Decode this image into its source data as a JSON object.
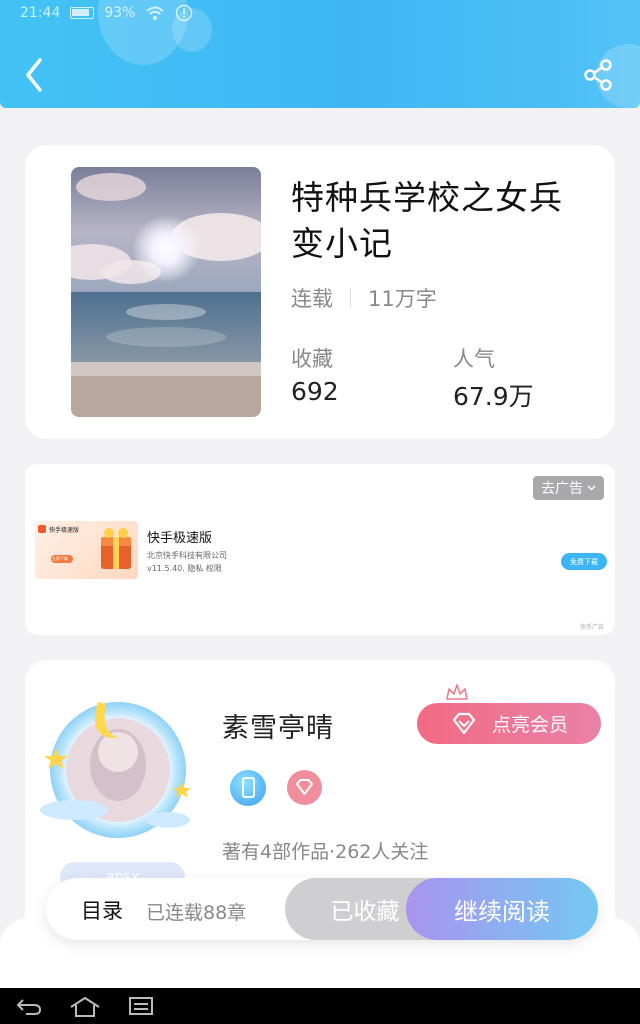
{
  "status_bar": {
    "time": "21:44",
    "battery": "93%"
  },
  "header": {
    "back_icon": "chevron-left-icon",
    "share_icon": "share-icon"
  },
  "book": {
    "title": "特种兵学校之女兵变小记",
    "status": "连载",
    "word_count": "11万字",
    "favorites_label": "收藏",
    "favorites_value": "692",
    "popularity_label": "人气",
    "popularity_value": "67.9万"
  },
  "ad": {
    "remove_label": "去广告",
    "app_name": "快手极速版",
    "company": "北京快手科技有限公司",
    "version_info": "v11.5.40.  隐私  权限",
    "download_label": "免费下载",
    "ad_tag": "快手广告",
    "thumb_title": "快手极速版",
    "thumb_button": "立即下载"
  },
  "author": {
    "name": "素雪亭晴",
    "vip_button": "点亮会员",
    "stats": "著有4部作品·262人关注",
    "avatar_tag": "ansx"
  },
  "action_bar": {
    "toc_label": "目录",
    "chapter_count": "已连载88章",
    "collected_label": "已收藏",
    "read_label": "继续阅读"
  },
  "colors": {
    "header_blue": "#43c3f5",
    "vip_pink": "#f26a82",
    "read_gradient_start": "#a994ef",
    "read_gradient_end": "#74c8f2"
  }
}
